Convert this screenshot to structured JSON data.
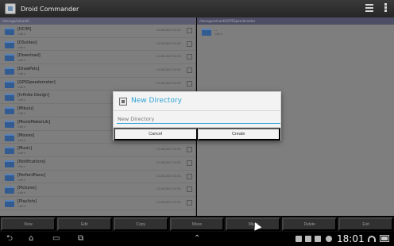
{
  "app": {
    "title": "Droid Commander"
  },
  "left_panel": {
    "path": "/storage/sdcard0",
    "items": [
      {
        "name": "[DCIM]",
        "meta": "<dir>",
        "date": "12.08.2013 10:51"
      },
      {
        "name": "[DSvideo]",
        "meta": "<dir>",
        "date": "12.08.2013 10:51"
      },
      {
        "name": "[Download]",
        "meta": "<dir>",
        "date": "12.08.2013 10:51"
      },
      {
        "name": "[DrawPets]",
        "meta": "<dir>",
        "date": "12.08.2013 10:51"
      },
      {
        "name": "[GPSSpeedometer]",
        "meta": "<dir>",
        "date": "12.08.2013 10:51"
      },
      {
        "name": "[Infinite Design]",
        "meta": "<dir>",
        "date": "12.08.2013 10:51"
      },
      {
        "name": "[Mikulu]",
        "meta": "<dir>",
        "date": "12.08.2013 10:51"
      },
      {
        "name": "[MovieMakerLib]",
        "meta": "<dir>",
        "date": "12.08.2013 10:51"
      },
      {
        "name": "[Movies]",
        "meta": "<dir>",
        "date": "12.08.2013 10:51"
      },
      {
        "name": "[Music]",
        "meta": "<dir>",
        "date": "12.08.2013 10:51"
      },
      {
        "name": "[Notifications]",
        "meta": "<dir>",
        "date": "12.08.2013 10:51"
      },
      {
        "name": "[PerfectPiano]",
        "meta": "<dir>",
        "date": "12.08.2013 10:51"
      },
      {
        "name": "[Pictures]",
        "meta": "<dir>",
        "date": "12.08.2013 10:51"
      },
      {
        "name": "[Playlists]",
        "meta": "<dir>",
        "date": "12.08.2013 10:51"
      }
    ]
  },
  "right_panel": {
    "path": "/storage/sdcard0/GPSSpeedometer",
    "up_item": {
      "name": "..",
      "meta": "<dir>"
    }
  },
  "dialog": {
    "title": "New Directory",
    "input_value": "",
    "input_placeholder": "New Directory",
    "cancel_label": "Cancel",
    "create_label": "Create"
  },
  "actions": [
    "View",
    "Edit",
    "Copy",
    "Move",
    "Mkdir",
    "Delete",
    "Exit"
  ],
  "status": {
    "clock": "18:01"
  },
  "colors": {
    "accent": "#2fa3d6",
    "folder": "#3d6fb3"
  }
}
